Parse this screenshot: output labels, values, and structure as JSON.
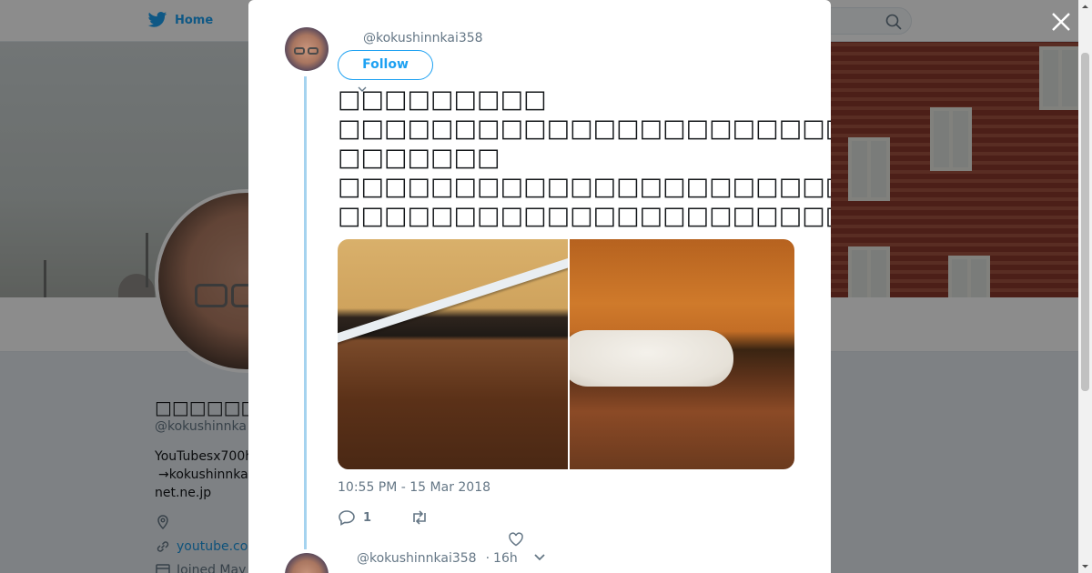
{
  "nav": {
    "home_label": "Home"
  },
  "profile": {
    "name": "□□□□□□□□",
    "handle": "@kokushinnka",
    "bio_lines": [
      "YouTubesx700h",
      "→kokushinnka",
      "net.ne.jp"
    ],
    "link": "youtube.com",
    "joined": "Joined May"
  },
  "tweet": {
    "handle": "@kokushinnkai358",
    "follow_label": "Follow",
    "text": "□□□□□□□□□\n□□□□□□□□□□□□□□□□□□□□□□□□□\n□□□□□□□\n□□□□□□□□□□□□□□□□□□□□□□□□□□□□□□□\n□□□□□□□□□□□□□□□□□□□□□□□□□",
    "timestamp": "10:55 PM - 15 Mar 2018",
    "reply_count": "1"
  },
  "next_tweet": {
    "handle": "@kokushinnkai358",
    "separator": "·",
    "time": "16h"
  },
  "icons": [
    "twitter-bird-icon",
    "search-icon",
    "close-icon",
    "reply-icon",
    "retweet-icon",
    "like-icon",
    "chevron-down-icon",
    "location-icon",
    "link-icon",
    "calendar-icon"
  ],
  "colors": {
    "accent": "#1da1f2",
    "thread_line": "#a5d3ef",
    "muted": "#657786",
    "overlay": "rgba(0,0,0,0.45)"
  }
}
